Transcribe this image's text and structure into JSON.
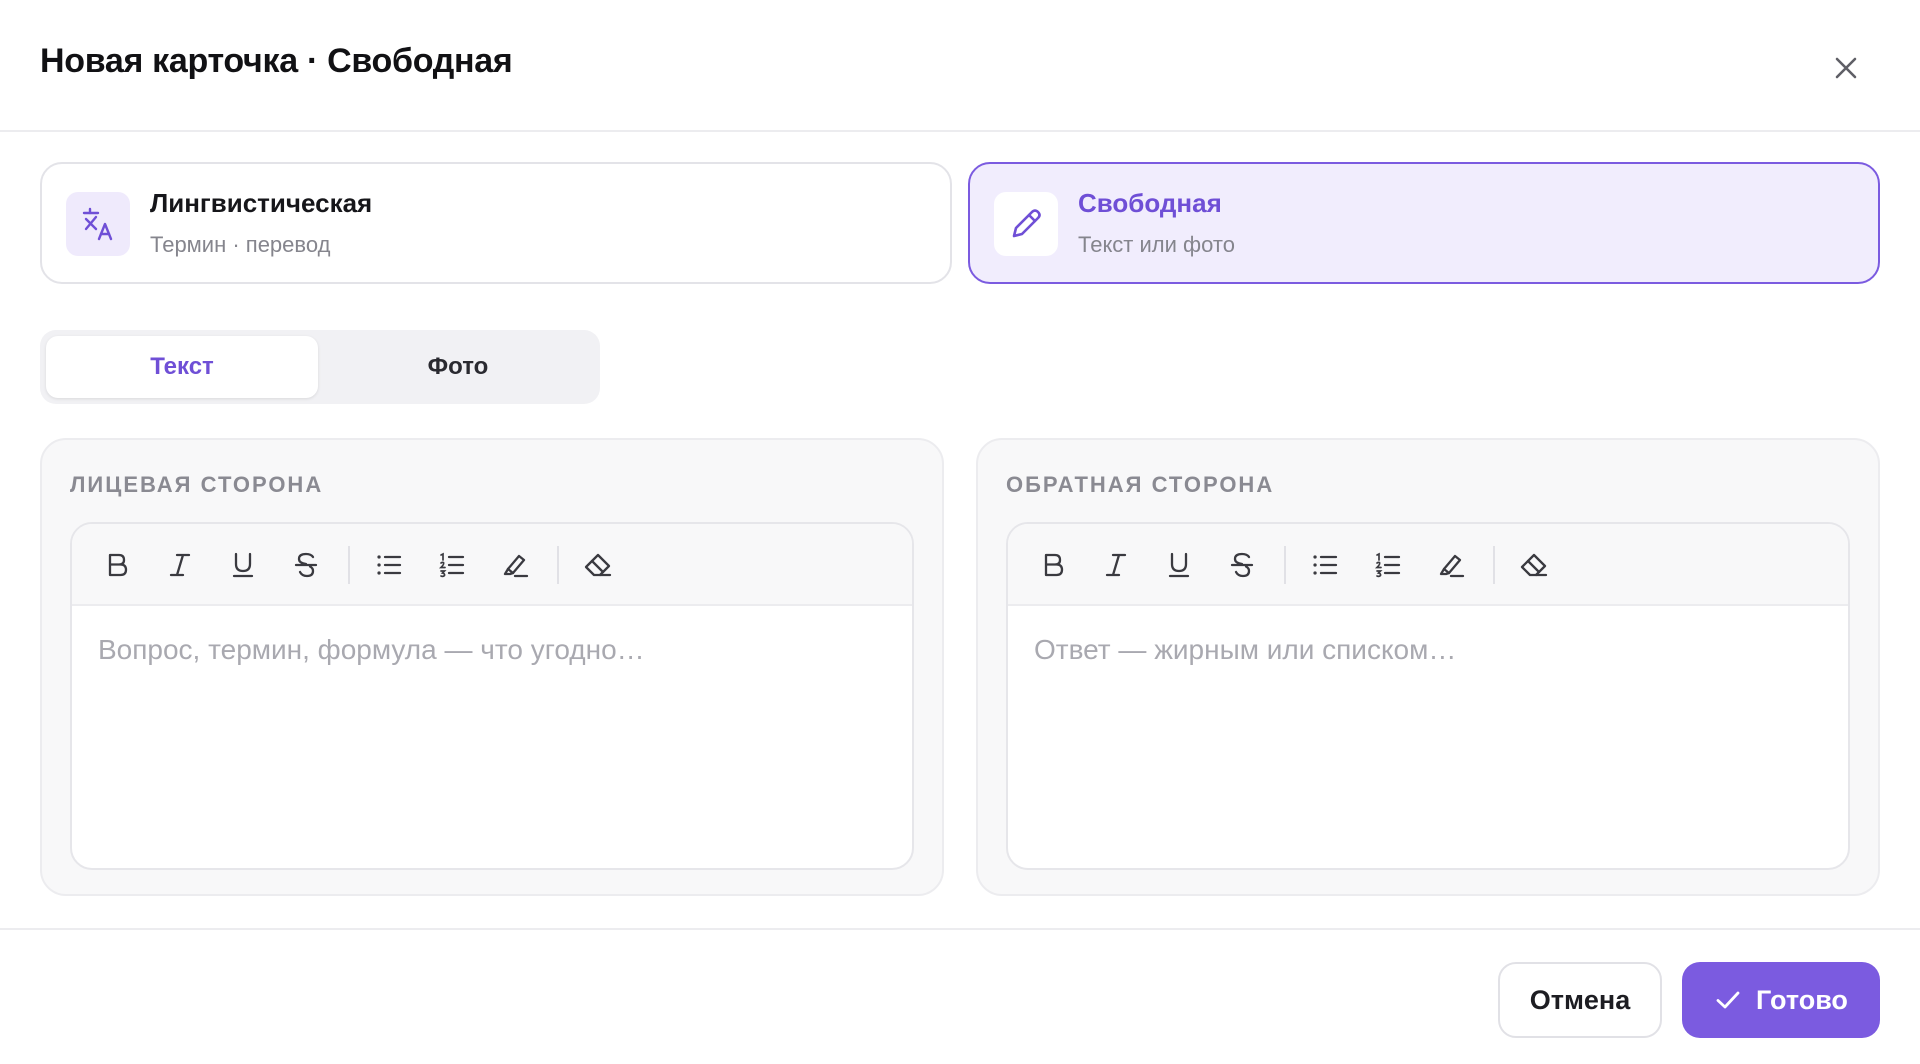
{
  "header": {
    "title": "Новая карточка · Свободная",
    "close_icon": "close-icon"
  },
  "card_types": [
    {
      "name": "Лингвистическая",
      "subtitle": "Термин · перевод",
      "icon": "translate-icon",
      "selected": false
    },
    {
      "name": "Свободная",
      "subtitle": "Текст или фото",
      "icon": "pencil-icon",
      "selected": true
    }
  ],
  "content_mode": {
    "options": [
      "Текст",
      "Фото"
    ],
    "selected": "Текст"
  },
  "front": {
    "label": "ЛИЦЕВАЯ СТОРОНА",
    "placeholder": "Вопрос, термин, формула — что угодно…",
    "value": ""
  },
  "back": {
    "label": "ОБРАТНАЯ СТОРОНА",
    "placeholder": "Ответ — жирным или списком…",
    "value": ""
  },
  "toolbar_icons": [
    "bold-icon",
    "italic-icon",
    "underline-icon",
    "strikethrough-icon",
    "bullet-list-icon",
    "numbered-list-icon",
    "highlighter-icon",
    "eraser-icon"
  ],
  "footer": {
    "cancel_label": "Отмена",
    "done_label": "Готово"
  },
  "colors": {
    "accent": "#7b5be0",
    "accent_text": "#6f4fd6",
    "selected_bg": "#f1edfd"
  }
}
